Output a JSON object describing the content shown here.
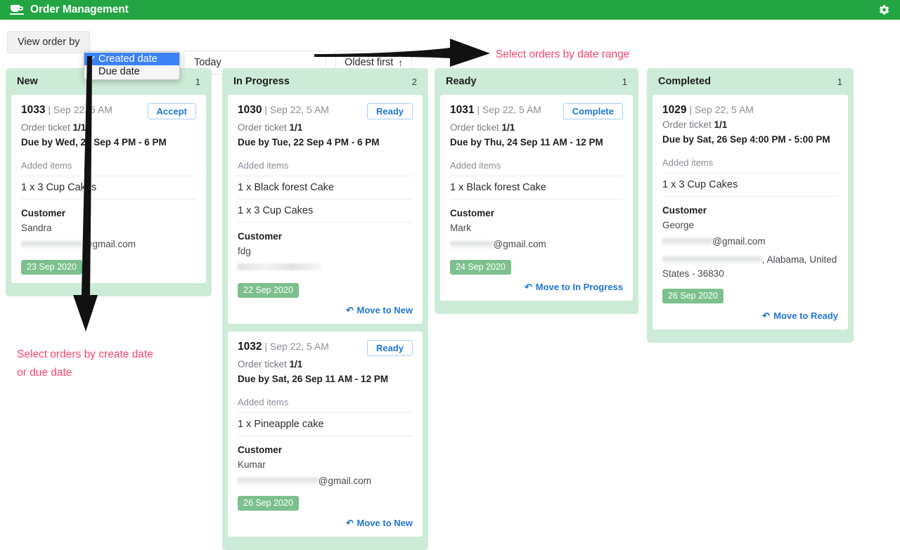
{
  "header": {
    "title": "Order Management",
    "logo_icon": "coffee-cup-icon",
    "settings_icon": "gear-icon",
    "bg_color": "#23a544"
  },
  "toolbar": {
    "view_order_by_label": "View order by",
    "date_range_value": "Today",
    "date_range_placeholder": "Today",
    "sort_order_label": "Oldest first",
    "sort_order_icon": "arrow-up-icon",
    "dropdown": {
      "open": true,
      "options": [
        {
          "label": "Created date",
          "selected": true,
          "check": "✓"
        },
        {
          "label": "Due date",
          "selected": false,
          "check": ""
        }
      ]
    }
  },
  "annotations": [
    {
      "name": "annotation-date-range",
      "text": "Select orders by date range",
      "color": "#f8456e"
    },
    {
      "name": "annotation-create-or-due-date",
      "text": "Select orders by create date\nor due date",
      "color": "#f8456e"
    }
  ],
  "board": {
    "columns": [
      {
        "id": "new",
        "title": "New",
        "count": "1",
        "cards": [
          {
            "order_no": "1033",
            "created": "| Sep 22, 5 AM",
            "action_label": "Accept",
            "ticket_label": "Order ticket",
            "ticket_value": "1/1",
            "due": "Due by Wed, 23 Sep 4 PM - 6 PM",
            "added_items_label": "Added items",
            "items": [
              "1 x 3 Cup Cakes"
            ],
            "customer_label": "Customer",
            "customer_name": "Sandra",
            "email_suffix": "@gmail.com",
            "address": "",
            "date_badge": "23 Sep 2020",
            "move_label": ""
          }
        ]
      },
      {
        "id": "in-progress",
        "title": "In Progress",
        "count": "2",
        "cards": [
          {
            "order_no": "1030",
            "created": "| Sep 22, 5 AM",
            "action_label": "Ready",
            "ticket_label": "Order ticket",
            "ticket_value": "1/1",
            "due": "Due by Tue, 22 Sep 4 PM - 6 PM",
            "added_items_label": "Added items",
            "items": [
              "1 x Black forest Cake",
              "1 x 3 Cup Cakes"
            ],
            "customer_label": "Customer",
            "customer_name": "fdg",
            "email_suffix": "",
            "address": "",
            "date_badge": "22 Sep 2020",
            "move_label": "Move to New"
          },
          {
            "order_no": "1032",
            "created": "| Sep 22, 5 AM",
            "action_label": "Ready",
            "ticket_label": "Order ticket",
            "ticket_value": "1/1",
            "due": "Due by Sat, 26 Sep 11 AM - 12 PM",
            "added_items_label": "Added items",
            "items": [
              "1 x Pineapple cake"
            ],
            "customer_label": "Customer",
            "customer_name": "Kumar",
            "email_suffix": "@gmail.com",
            "address": "",
            "date_badge": "26 Sep 2020",
            "move_label": "Move to New"
          }
        ]
      },
      {
        "id": "ready",
        "title": "Ready",
        "count": "1",
        "cards": [
          {
            "order_no": "1031",
            "created": "| Sep 22, 5 AM",
            "action_label": "Complete",
            "ticket_label": "Order ticket",
            "ticket_value": "1/1",
            "due": "Due by Thu, 24 Sep 11 AM - 12 PM",
            "added_items_label": "Added items",
            "items": [
              "1 x Black forest Cake"
            ],
            "customer_label": "Customer",
            "customer_name": "Mark",
            "email_suffix": "@gmail.com",
            "address": "",
            "date_badge": "24 Sep 2020",
            "move_label": "Move to In Progress"
          }
        ]
      },
      {
        "id": "completed",
        "title": "Completed",
        "count": "1",
        "cards": [
          {
            "order_no": "1029",
            "created": "| Sep 22, 5 AM",
            "action_label": "",
            "ticket_label": "Order ticket",
            "ticket_value": "1/1",
            "due": "Due by Sat, 26 Sep 4:00 PM - 5:00 PM",
            "added_items_label": "Added items",
            "items": [
              "1 x 3 Cup Cakes"
            ],
            "customer_label": "Customer",
            "customer_name": "George",
            "email_suffix": "@gmail.com",
            "address": ", Alabama, United States - 36830",
            "date_badge": "26 Sep 2020",
            "move_label": "Move to Ready"
          }
        ]
      }
    ]
  }
}
